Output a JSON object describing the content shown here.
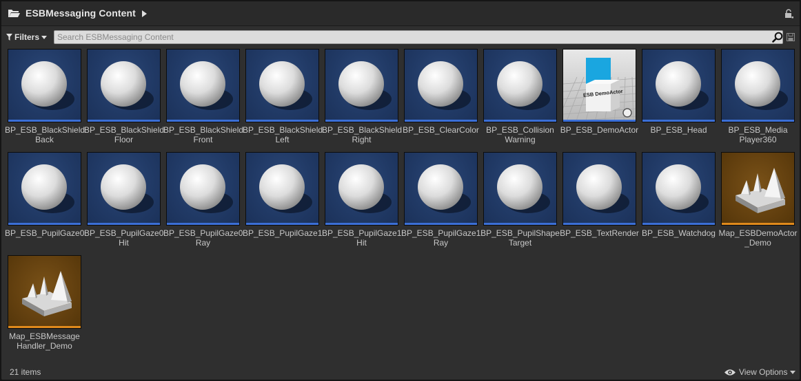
{
  "header": {
    "path": "ESBMessaging Content"
  },
  "toolbar": {
    "filters_label": "Filters",
    "search_placeholder": "Search ESBMessaging Content",
    "search_value": ""
  },
  "colors": {
    "blueprint_accent": "#3b6fd6",
    "map_accent": "#e08a1c"
  },
  "assets": [
    {
      "name": "BP_ESB_BlackShield\nBack",
      "type": "blueprint"
    },
    {
      "name": "BP_ESB_BlackShield\nFloor",
      "type": "blueprint"
    },
    {
      "name": "BP_ESB_BlackShield\nFront",
      "type": "blueprint"
    },
    {
      "name": "BP_ESB_BlackShield\nLeft",
      "type": "blueprint"
    },
    {
      "name": "BP_ESB_BlackShield\nRight",
      "type": "blueprint"
    },
    {
      "name": "BP_ESB_ClearColor",
      "type": "blueprint"
    },
    {
      "name": "BP_ESB_Collision\nWarning",
      "type": "blueprint"
    },
    {
      "name": "BP_ESB_DemoActor",
      "type": "blueprint-actor",
      "thumbnail_text": "ESB DemoActor"
    },
    {
      "name": "BP_ESB_Head",
      "type": "blueprint"
    },
    {
      "name": "BP_ESB_Media\nPlayer360",
      "type": "blueprint"
    },
    {
      "name": "BP_ESB_PupilGaze0",
      "type": "blueprint"
    },
    {
      "name": "BP_ESB_PupilGaze0\nHit",
      "type": "blueprint"
    },
    {
      "name": "BP_ESB_PupilGaze0\nRay",
      "type": "blueprint"
    },
    {
      "name": "BP_ESB_PupilGaze1",
      "type": "blueprint"
    },
    {
      "name": "BP_ESB_PupilGaze1\nHit",
      "type": "blueprint"
    },
    {
      "name": "BP_ESB_PupilGaze1\nRay",
      "type": "blueprint"
    },
    {
      "name": "BP_ESB_PupilShape\nTarget",
      "type": "blueprint"
    },
    {
      "name": "BP_ESB_TextRender",
      "type": "blueprint"
    },
    {
      "name": "BP_ESB_Watchdog",
      "type": "blueprint"
    },
    {
      "name": "Map_ESBDemoActor\n_Demo",
      "type": "map"
    },
    {
      "name": "Map_ESBMessage\nHandler_Demo",
      "type": "map"
    }
  ],
  "footer": {
    "item_count": "21 items",
    "view_options_label": "View Options"
  }
}
